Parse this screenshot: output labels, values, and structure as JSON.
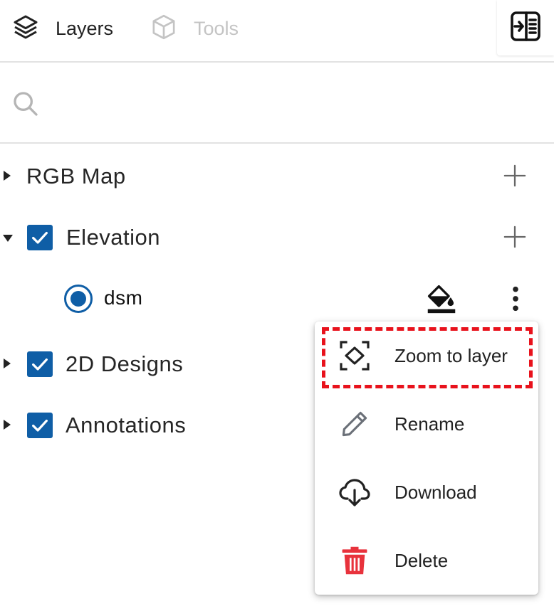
{
  "tabs": [
    {
      "label": "Layers",
      "icon": "layers-icon",
      "active": true
    },
    {
      "label": "Tools",
      "icon": "cube-icon",
      "active": false
    }
  ],
  "search": {
    "placeholder": "",
    "value": ""
  },
  "layers": [
    {
      "label": "RGB Map",
      "expanded": false,
      "checked": null
    },
    {
      "label": "Elevation",
      "expanded": true,
      "checked": true,
      "children": [
        {
          "label": "dsm",
          "selected": true
        }
      ]
    },
    {
      "label": "2D Designs",
      "expanded": false,
      "checked": true
    },
    {
      "label": "Annotations",
      "expanded": false,
      "checked": true
    }
  ],
  "context_menu": {
    "items": [
      {
        "label": "Zoom to layer",
        "icon": "zoom-to-layer-icon",
        "highlighted": true
      },
      {
        "label": "Rename",
        "icon": "pencil-icon"
      },
      {
        "label": "Download",
        "icon": "cloud-download-icon"
      },
      {
        "label": "Delete",
        "icon": "trash-icon",
        "icon_color": "#e8323c"
      }
    ]
  },
  "colors": {
    "accent": "#0f5ea6",
    "highlight_border": "#e8121c",
    "delete": "#e8323c",
    "disabled_text": "#c4c4c4"
  }
}
